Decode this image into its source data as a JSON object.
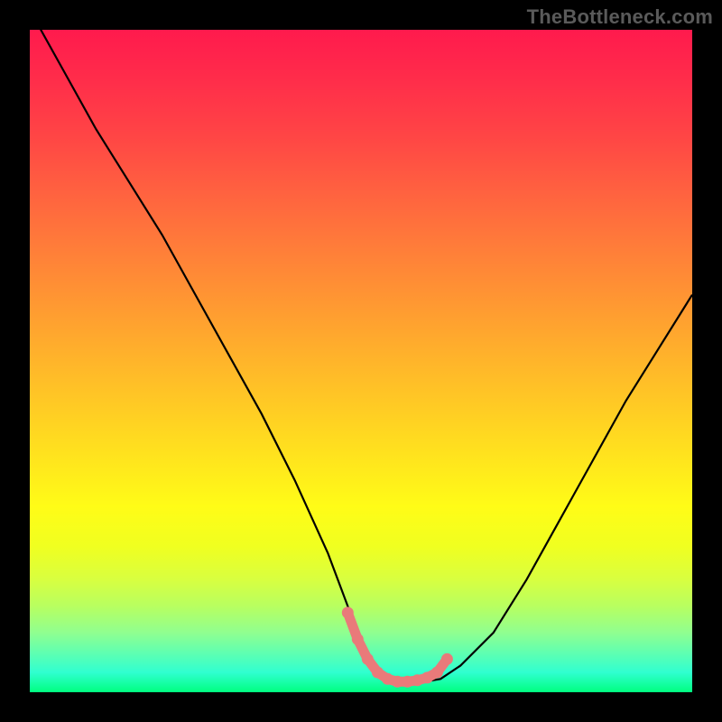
{
  "watermark": "TheBottleneck.com",
  "chart_data": {
    "type": "line",
    "title": "",
    "xlabel": "",
    "ylabel": "",
    "xlim": [
      0,
      100
    ],
    "ylim": [
      0,
      100
    ],
    "series": [
      {
        "name": "curve",
        "color": "#000000",
        "x": [
          0,
          5,
          10,
          15,
          20,
          25,
          30,
          35,
          40,
          45,
          48,
          50,
          52,
          55,
          57,
          59,
          62,
          65,
          70,
          75,
          80,
          85,
          90,
          95,
          100
        ],
        "y": [
          103,
          94,
          85,
          77,
          69,
          60,
          51,
          42,
          32,
          21,
          13,
          8,
          4,
          2,
          1.5,
          1.5,
          2,
          4,
          9,
          17,
          26,
          35,
          44,
          52,
          60
        ]
      },
      {
        "name": "highlight",
        "color": "#e97a7a",
        "x": [
          48,
          49.5,
          51,
          52.5,
          54,
          55.5,
          57,
          58.5,
          60,
          61.5,
          63
        ],
        "y": [
          12,
          8,
          5,
          3,
          2,
          1.6,
          1.6,
          1.8,
          2.2,
          3,
          5
        ]
      }
    ]
  }
}
